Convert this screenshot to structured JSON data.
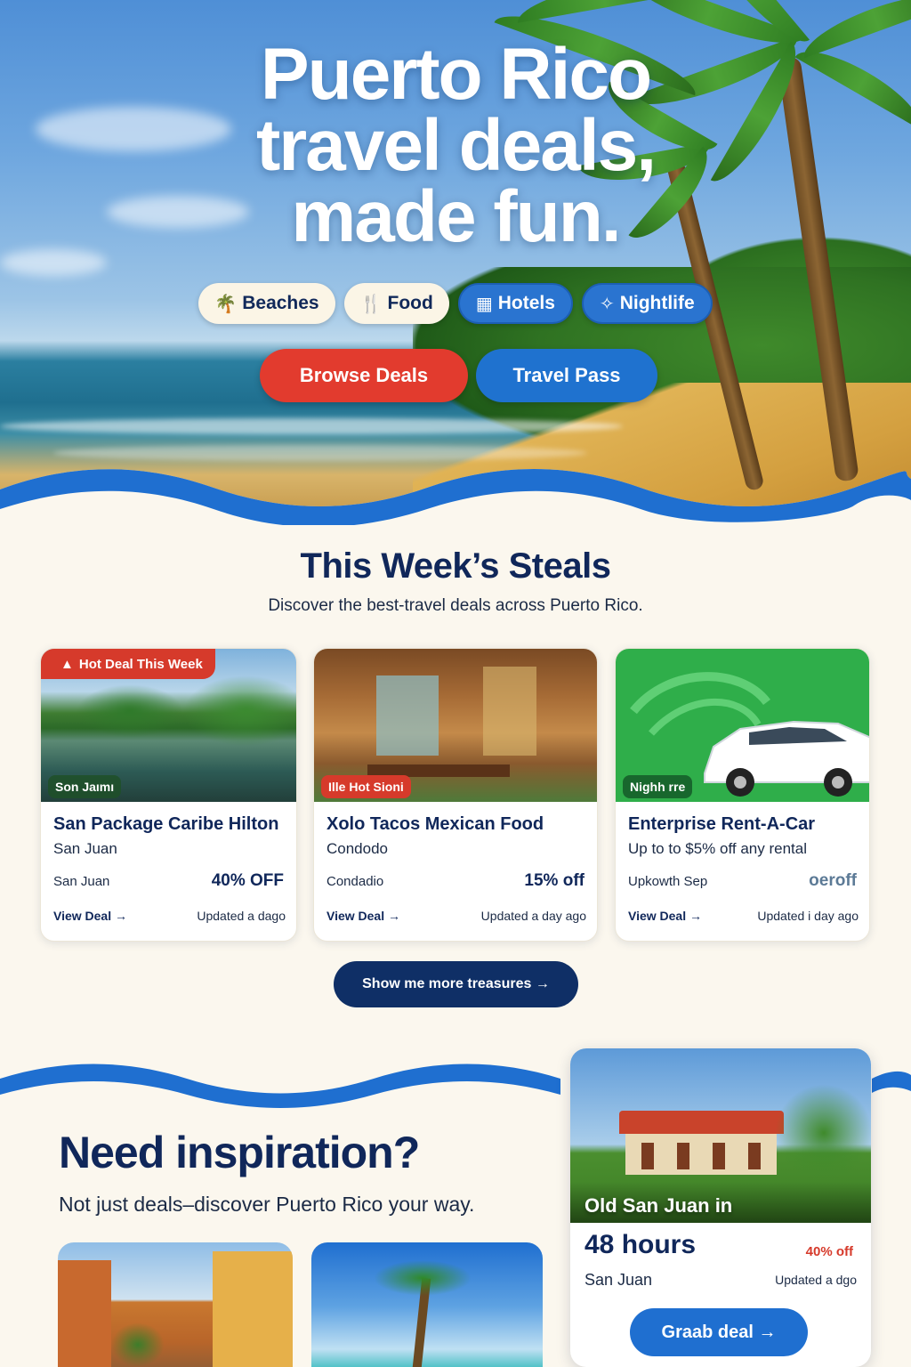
{
  "hero": {
    "title_lines": [
      "Puerto Rico",
      "travel deals,",
      "made fun."
    ],
    "chips": [
      {
        "label": "Beaches",
        "icon": "palm-tree-icon",
        "glyph": "🌴"
      },
      {
        "label": "Food",
        "icon": "food-icon",
        "glyph": "🍴"
      },
      {
        "label": "Hotels",
        "icon": "hotel-icon",
        "glyph": "▦"
      },
      {
        "label": "Nightlife",
        "icon": "nightlife-icon",
        "glyph": "✧"
      }
    ],
    "primary_cta": "Browse Deals",
    "secondary_cta": "Travel Pass"
  },
  "steals": {
    "title": "This Week’s Steals",
    "subtitle": "Discover the best-travel deals across Puerto Rico.",
    "cards": [
      {
        "ribbon": "Hot Deal This Week",
        "tag": "Son Jaımı",
        "title": "San Package Caribe Hilton",
        "subtitle": "San Juan",
        "location": "San Juan",
        "discount": "40% OFF",
        "link": "View Deal →",
        "updated": "Updated a dago"
      },
      {
        "tag": "Ille Hot Sioni",
        "title": "Xolo Tacos Mexican Food",
        "subtitle": "Condodo",
        "location": "Condadio",
        "discount": "15% off",
        "link": "View Deal →",
        "updated": "Updated a day ago"
      },
      {
        "tag": "Nighh rre",
        "title": "Enterprise Rent-A-Car",
        "subtitle": "Up to to $5% off any rental",
        "location": "Upkowth Sep",
        "discount": "oeroff",
        "link": "View Deal →",
        "updated": "Updated i day ago"
      }
    ],
    "more_button": "Show me more treasures →"
  },
  "inspiration": {
    "title": "Need inspiration?",
    "subtitle": "Not just deals–discover Puerto Rico your way."
  },
  "feature": {
    "caption": "Old San Juan in",
    "headline": "48 hours",
    "discount": "40% off",
    "location": "San Juan",
    "updated": "Updated a dgo",
    "button": "Graab deal →"
  },
  "colors": {
    "navy": "#10275a",
    "red": "#e23b2e",
    "blue": "#1f72cf",
    "cream": "#fbf7ee",
    "green_card": "#2fae4a"
  }
}
